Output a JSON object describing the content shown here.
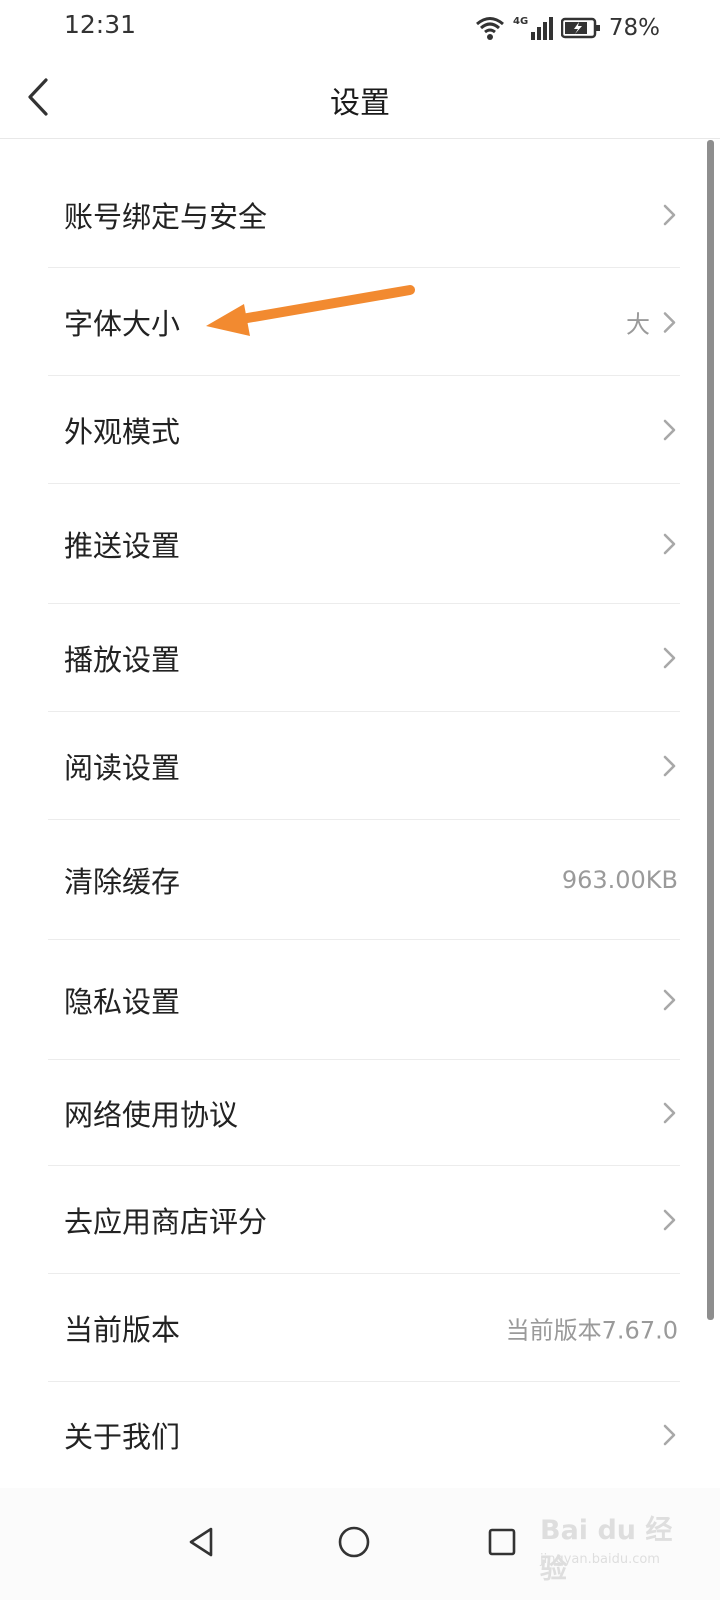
{
  "status_bar": {
    "time": "12:31",
    "network": "4G",
    "battery_percent": "78%",
    "icons": [
      "wifi-icon",
      "cellular-signal-icon",
      "battery-icon"
    ]
  },
  "header": {
    "title": "设置",
    "back_icon": "chevron-left-icon"
  },
  "settings": {
    "items": [
      {
        "label": "账号绑定与安全",
        "value": "",
        "chevron": true
      },
      {
        "label": "字体大小",
        "value": "大",
        "chevron": true
      },
      {
        "label": "外观模式",
        "value": "",
        "chevron": true
      },
      {
        "label": "推送设置",
        "value": "",
        "chevron": true
      },
      {
        "label": "播放设置",
        "value": "",
        "chevron": true
      },
      {
        "label": "阅读设置",
        "value": "",
        "chevron": true
      },
      {
        "label": "清除缓存",
        "value": "963.00KB",
        "chevron": false
      },
      {
        "label": "隐私设置",
        "value": "",
        "chevron": true
      },
      {
        "label": "网络使用协议",
        "value": "",
        "chevron": true
      },
      {
        "label": "去应用商店评分",
        "value": "",
        "chevron": true
      },
      {
        "label": "当前版本",
        "value": "当前版本7.67.0",
        "chevron": false
      },
      {
        "label": "关于我们",
        "value": "",
        "chevron": true
      }
    ]
  },
  "nav_bar": {
    "buttons": [
      "back-triangle-icon",
      "home-circle-icon",
      "recents-square-icon"
    ]
  },
  "annotation": {
    "color": "#f28a30"
  },
  "watermark": {
    "text": "Bai du 经验",
    "sub": "jingyan.baidu.com"
  },
  "colors": {
    "value_text": "#9a9a9a",
    "chevron": "#a8a8a8",
    "accent_arrow": "#f28a30"
  }
}
